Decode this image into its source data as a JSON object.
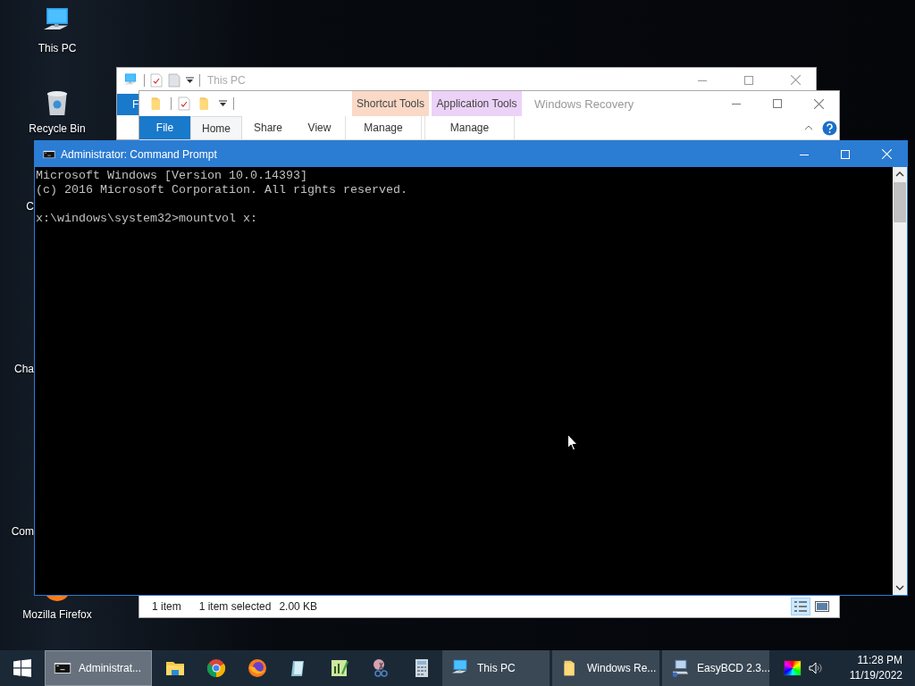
{
  "desktop_icons": [
    {
      "label": "This PC",
      "kind": "pc"
    },
    {
      "label": "Recycle Bin",
      "kind": "bin"
    },
    {
      "label": "C",
      "kind": "hidden"
    },
    {
      "label": "Cha",
      "kind": "hidden"
    },
    {
      "label": "Com",
      "kind": "hidden"
    },
    {
      "label": "Mozilla Firefox",
      "kind": "firefox"
    }
  ],
  "back_window": {
    "title": "This PC",
    "file_tab": "F"
  },
  "explorer_window": {
    "title": "Windows Recovery",
    "contextual_tabs": [
      {
        "label": "Shortcut Tools",
        "color": "#fad9c6"
      },
      {
        "label": "Application Tools",
        "color": "#ecd2f7"
      }
    ],
    "tabs": [
      {
        "label": "File",
        "kind": "file",
        "selected": false
      },
      {
        "label": "Home",
        "kind": "tab",
        "selected": true
      },
      {
        "label": "Share",
        "kind": "tab",
        "selected": false
      },
      {
        "label": "View",
        "kind": "tab",
        "selected": false
      },
      {
        "label": "Manage",
        "kind": "context",
        "selected": false
      },
      {
        "label": "Manage",
        "kind": "context",
        "selected": false
      }
    ],
    "status": [
      "1 item",
      "1 item selected",
      "2.00 KB"
    ],
    "views": [
      {
        "kind": "details",
        "selected": true
      },
      {
        "kind": "thumbnails",
        "selected": false
      }
    ]
  },
  "command_prompt": {
    "title": "Administrator: Command Prompt",
    "lines": [
      "Microsoft Windows [Version 10.0.14393]",
      "(c) 2016 Microsoft Corporation. All rights reserved."
    ],
    "prompt": "x:\\windows\\system32>mountvol x:"
  },
  "taskbar": {
    "buttons": [
      {
        "label": "Administrat...",
        "kind": "cmd",
        "selected": true
      },
      {
        "kind": "explorer"
      },
      {
        "kind": "chrome"
      },
      {
        "kind": "firefox"
      },
      {
        "kind": "notepad"
      },
      {
        "kind": "chart"
      },
      {
        "kind": "snip"
      },
      {
        "kind": "calc"
      },
      {
        "label": "This PC",
        "kind": "pc",
        "selected": false
      },
      {
        "label": "Windows Re...",
        "kind": "folder",
        "selected": false
      },
      {
        "label": "EasyBCD 2.3...",
        "kind": "easybcd",
        "selected": false
      }
    ],
    "clock": {
      "time": "11:28 PM",
      "date": "11/19/2022"
    }
  }
}
